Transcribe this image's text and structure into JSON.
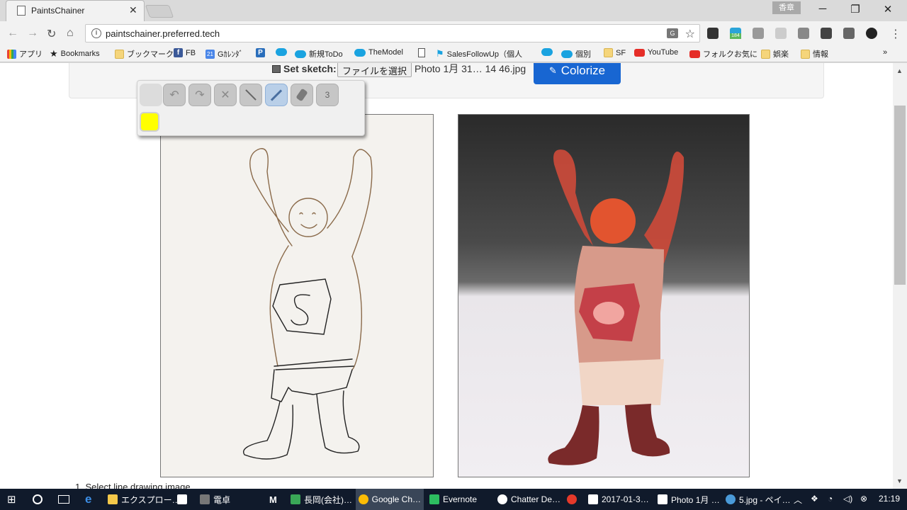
{
  "browser": {
    "tab_title": "PaintsChainer",
    "ime_badge": "香章",
    "url": "paintschainer.preferred.tech",
    "ext_badge": "184"
  },
  "bookmarks": [
    {
      "label": "アプリ",
      "icon": "apps-grid-icon"
    },
    {
      "label": "Bookmarks",
      "icon": "star-icon"
    },
    {
      "label": "ブックマーク",
      "icon": "folder-icon"
    },
    {
      "label": "FB",
      "icon": "facebook-icon"
    },
    {
      "label": "Gｶﾚﾝﾀﾞ",
      "icon": "calendar-icon"
    },
    {
      "label": "",
      "icon": "p-icon"
    },
    {
      "label": "",
      "icon": "salesforce-icon"
    },
    {
      "label": "新規ToDo",
      "icon": "salesforce-icon"
    },
    {
      "label": "TheModel",
      "icon": "salesforce-icon"
    },
    {
      "label": "",
      "icon": "page-icon"
    },
    {
      "label": "SalesFollowUp（個人",
      "icon": "runner-icon"
    },
    {
      "label": "",
      "icon": "salesforce-icon"
    },
    {
      "label": "個別",
      "icon": "salesforce-icon"
    },
    {
      "label": "SF",
      "icon": "folder-icon"
    },
    {
      "label": "YouTube",
      "icon": "youtube-icon"
    },
    {
      "label": "フォルクお気に",
      "icon": "youtube-icon"
    },
    {
      "label": "娯楽",
      "icon": "folder-icon"
    },
    {
      "label": "情報",
      "icon": "folder-icon"
    }
  ],
  "page": {
    "set_sketch_label": "Set sketch:",
    "file_button": "ファイルを選択",
    "file_name": "Photo 1月 31… 14 46.jpg",
    "colorize_button": "Colorize",
    "brush_size": "3",
    "pen_color": "#ffff00",
    "instruction": "1. Select line drawing image"
  },
  "taskbar": {
    "items": [
      {
        "label": "エクスプロー…",
        "icon": "folder-icon"
      },
      {
        "label": "電卓",
        "icon": "calculator-icon"
      },
      {
        "label": "長岡(会社)…",
        "icon": "sheet-icon"
      },
      {
        "label": "Google Ch…",
        "icon": "chrome-icon"
      },
      {
        "label": "Evernote",
        "icon": "evernote-icon"
      },
      {
        "label": "Chatter De…",
        "icon": "chatter-icon"
      },
      {
        "label": "2017-01-3…",
        "icon": "image-icon"
      },
      {
        "label": "Photo 1月 …",
        "icon": "image-icon"
      },
      {
        "label": "5.jpg - ペイ…",
        "icon": "paint-icon"
      }
    ],
    "time": "21:19"
  }
}
